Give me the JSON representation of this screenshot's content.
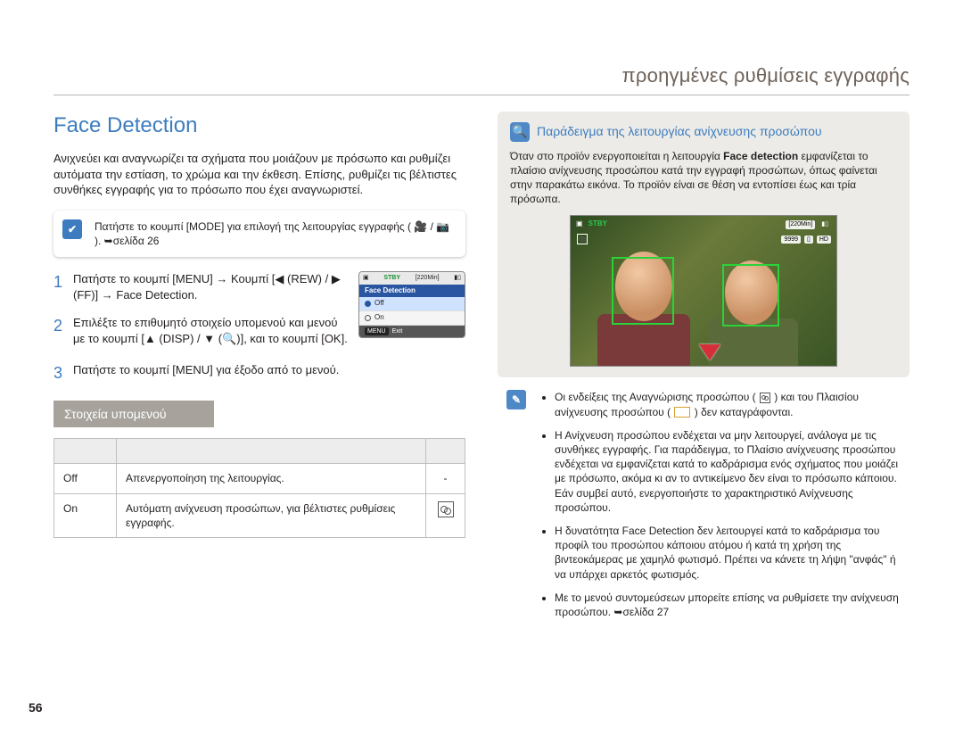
{
  "header": {
    "section_title": "προηγμένες ρυθμίσεις εγγραφής"
  },
  "left": {
    "title": "Face Detection",
    "intro": "Ανιχνεύει και αναγνωρίζει τα σχήματα που μοιάζουν με πρόσωπο και ρυθμίζει αυτόματα την εστίαση, το χρώμα και την έκθεση. Επίσης, ρυθμίζει τις βέλτιστες συνθήκες εγγραφής για το πρόσωπο που έχει αναγνωριστεί.",
    "note": "Πατήστε το κουμπί [MODE] για επιλογή της λειτουργίας εγγραφής ( 🎥 / 📷 ). ➥σελίδα 26",
    "steps": [
      {
        "num": "1",
        "text": "Πατήστε το κουμπί [MENU] → Κουμπί [◀ (REW) / ▶ (FF)] → Face Detection."
      },
      {
        "num": "2",
        "text": "Επιλέξτε το επιθυμητό στοιχείο υπομενού και μενού με το κουμπί [▲ (DISP) / ▼ (🔍)], και το κουμπί [OK]."
      },
      {
        "num": "3",
        "text": "Πατήστε το κουμπί [MENU] για έξοδο από το μενού."
      }
    ],
    "lcd": {
      "stby": "STBY",
      "time": "[220Min]",
      "title": "Face Detection",
      "opt_off": "Off",
      "opt_on": "On",
      "menu": "MENU",
      "exit": "Exit"
    },
    "sub_heading": "Στοιχεία υπομενού",
    "table": {
      "headers": [
        "",
        "",
        ""
      ],
      "rows": [
        {
          "item": "Off",
          "desc": "Απενεργοποίηση της λειτουργίας.",
          "icon": "-"
        },
        {
          "item": "On",
          "desc": "Αυτόματη ανίχνευση προσώπων, για βέλτιστες ρυθμίσεις εγγραφής.",
          "icon": "glyph"
        }
      ]
    }
  },
  "right": {
    "example_title": "Παράδειγμα της λειτουργίας ανίχνευσης προσώπου",
    "example_text_a": "Όταν στο προϊόν ενεργοποιείται η λειτουργία ",
    "example_text_bold": "Face detection",
    "example_text_b": " εμφανίζεται το πλαίσιο ανίχνευσης προσώπου κατά την εγγραφή προσώπων, όπως φαίνεται στην παρακάτω εικόνα. Το προϊόν είναι σε θέση να εντοπίσει έως και τρία πρόσωπα.",
    "overlay": {
      "stby": "STBY",
      "time": "[220Min]",
      "shots": "9999",
      "hd": "HD"
    },
    "tips": [
      "Οι ενδείξεις της Αναγνώρισης προσώπου ( {fd} ) και του Πλαισίου ανίχνευσης προσώπου ( {frame} ) δεν καταγράφονται.",
      "Η Ανίχνευση προσώπου ενδέχεται να μην λειτουργεί, ανάλογα με τις συνθήκες εγγραφής. Για παράδειγμα, το Πλαίσιο ανίχνευσης προσώπου ενδέχεται να εμφανίζεται κατά το καδράρισμα ενός σχήματος που μοιάζει με πρόσωπο, ακόμα κι αν το αντικείμενο δεν είναι το πρόσωπο κάποιου. Εάν συμβεί αυτό, ενεργοποιήστε το χαρακτηριστικό Ανίχνευσης προσώπου.",
      "Η δυνατότητα Face Detection δεν λειτουργεί κατά το καδράρισμα του προφίλ του προσώπου κάποιου ατόμου ή κατά τη χρήση της βιντεοκάμερας με χαμηλό φωτισμό. Πρέπει να κάνετε τη λήψη \"ανφάς\" ή να υπάρχει αρκετός φωτισμός.",
      "Με το μενού συντομεύσεων μπορείτε επίσης να ρυθμίσετε την ανίχνευση προσώπου. ➥σελίδα 27"
    ]
  },
  "page_number": "56"
}
